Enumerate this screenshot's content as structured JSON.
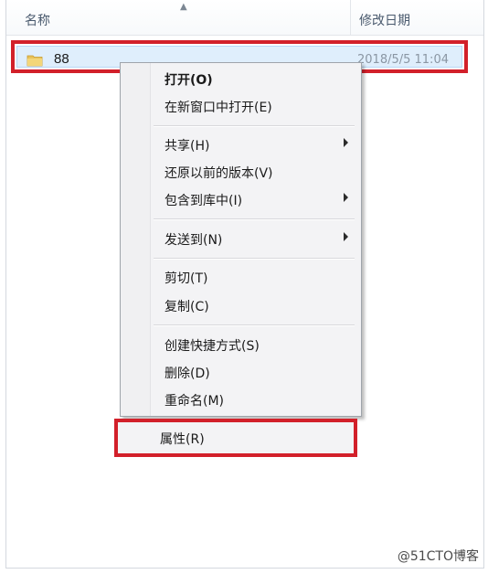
{
  "header": {
    "name_col": "名称",
    "date_col": "修改日期"
  },
  "file": {
    "name": "88",
    "date": "2018/5/5 11:04",
    "icon": "folder-icon"
  },
  "menu": {
    "items": [
      {
        "label": "打开(O)",
        "bold": true
      },
      {
        "label": "在新窗口中打开(E)"
      },
      {
        "label": "共享(H)",
        "submenu": true
      },
      {
        "label": "还原以前的版本(V)"
      },
      {
        "label": "包含到库中(I)",
        "submenu": true
      },
      {
        "label": "发送到(N)",
        "submenu": true
      },
      {
        "label": "剪切(T)"
      },
      {
        "label": "复制(C)"
      },
      {
        "label": "创建快捷方式(S)"
      },
      {
        "label": "删除(D)"
      },
      {
        "label": "重命名(M)"
      },
      {
        "label": "属性(R)"
      }
    ]
  },
  "highlight_color": "#d2202a",
  "watermark": "@51CTO博客"
}
